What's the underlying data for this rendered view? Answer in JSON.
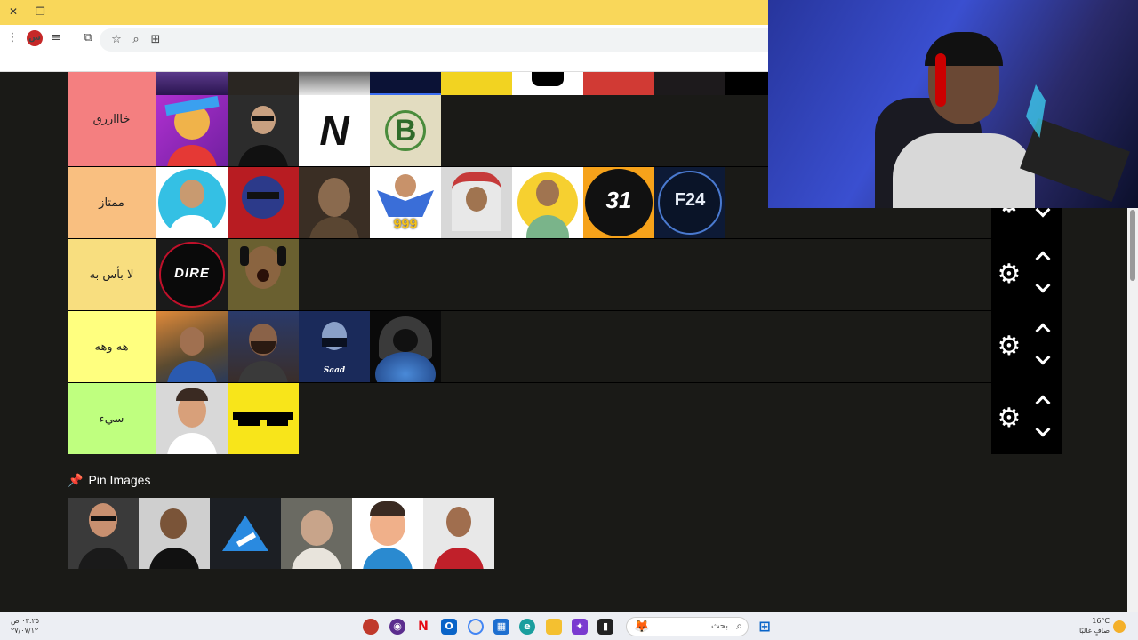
{
  "window": {
    "close_glyph": "✕",
    "restore_glyph": "❐",
    "minimize_glyph": "—"
  },
  "toolbar": {
    "extension_badge": "س"
  },
  "tiers": [
    {
      "label": "خاااررق",
      "color": "#f47f80"
    },
    {
      "label": "ممتاز",
      "color": "#f9bf80"
    },
    {
      "label": "لا بأس به",
      "color": "#f8de7f"
    },
    {
      "label": "هه وهه",
      "color": "#ffff7f"
    },
    {
      "label": "سيء",
      "color": "#bfff7f"
    }
  ],
  "tier_images": {
    "row1_logo_n": "N",
    "row2_logo_31": "31",
    "row2_logo_f24": "F24",
    "row2_badge_999": "999",
    "row3_logo": "DIRE",
    "row4_caption": "Saad"
  },
  "pin": {
    "title": "Pin Images",
    "pin_icon": "pin-icon"
  },
  "taskbar": {
    "time": "٠٣:٢٥ ص",
    "date": "٢٧/٠٧/١٢",
    "search_placeholder": "بحث",
    "temp": "16°C",
    "weather": "صافٍ غالبًا"
  },
  "colors": {
    "page_bg": "#1a1a17",
    "titlebar": "#f9d75a",
    "control_bg": "#000000"
  }
}
